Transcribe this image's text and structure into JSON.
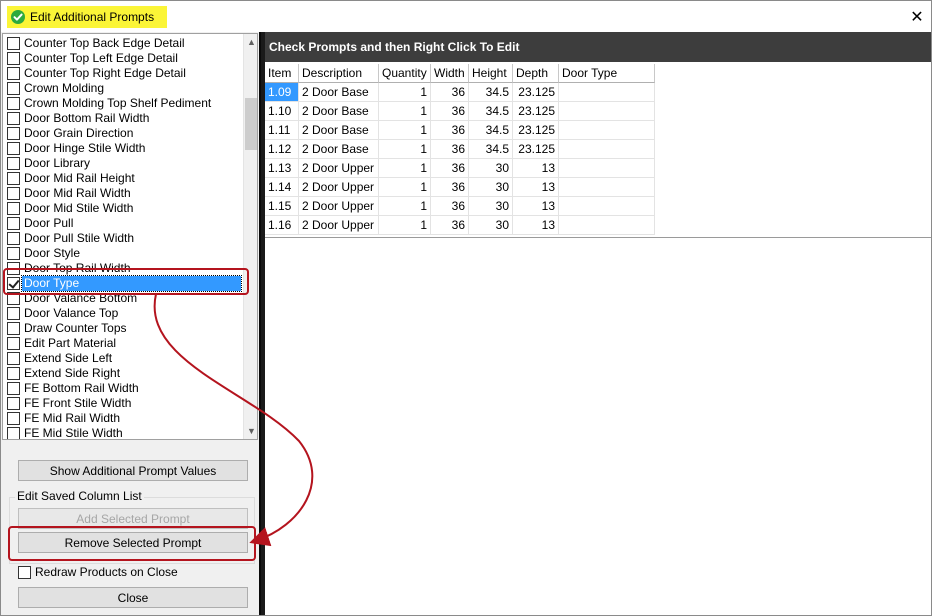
{
  "window": {
    "title": "Edit Additional Prompts",
    "close_glyph": "✕"
  },
  "prompt_list": {
    "items": [
      {
        "label": "Counter Top Back Edge Detail",
        "checked": false
      },
      {
        "label": "Counter Top Left Edge Detail",
        "checked": false
      },
      {
        "label": "Counter Top Right Edge Detail",
        "checked": false
      },
      {
        "label": "Crown Molding",
        "checked": false
      },
      {
        "label": "Crown Molding Top Shelf Pediment",
        "checked": false
      },
      {
        "label": "Door Bottom Rail Width",
        "checked": false
      },
      {
        "label": "Door Grain Direction",
        "checked": false
      },
      {
        "label": "Door Hinge Stile Width",
        "checked": false
      },
      {
        "label": "Door Library",
        "checked": false
      },
      {
        "label": "Door Mid Rail Height",
        "checked": false
      },
      {
        "label": "Door Mid Rail Width",
        "checked": false
      },
      {
        "label": "Door Mid Stile Width",
        "checked": false
      },
      {
        "label": "Door Pull",
        "checked": false
      },
      {
        "label": "Door Pull Stile Width",
        "checked": false
      },
      {
        "label": "Door Style",
        "checked": false
      },
      {
        "label": "Door Top Rail Width",
        "checked": false
      },
      {
        "label": "Door Type",
        "checked": true,
        "selected": true
      },
      {
        "label": "Door Valance Bottom",
        "checked": false
      },
      {
        "label": "Door Valance Top",
        "checked": false
      },
      {
        "label": "Draw Counter Tops",
        "checked": false
      },
      {
        "label": "Edit Part Material",
        "checked": false
      },
      {
        "label": "Extend Side Left",
        "checked": false
      },
      {
        "label": "Extend Side Right",
        "checked": false
      },
      {
        "label": "FE Bottom Rail Width",
        "checked": false
      },
      {
        "label": "FE Front Stile Width",
        "checked": false
      },
      {
        "label": "FE Mid Rail Width",
        "checked": false
      },
      {
        "label": "FE Mid Stile Width",
        "checked": false
      }
    ]
  },
  "buttons": {
    "show_values": "Show Additional Prompt Values",
    "add_selected": "Add Selected Prompt",
    "remove_selected": "Remove Selected Prompt",
    "close": "Close"
  },
  "saved_columns": {
    "group_label": "Edit Saved Column List"
  },
  "redraw": {
    "label": "Redraw Products on Close",
    "checked": false
  },
  "right_panel": {
    "header": "Check Prompts and then Right Click To Edit"
  },
  "grid": {
    "columns": [
      "Item",
      "Description",
      "Quantity",
      "Width",
      "Height",
      "Depth",
      "Door Type"
    ],
    "rows": [
      [
        "1.09",
        "2 Door Base",
        "1",
        "36",
        "34.5",
        "23.125",
        ""
      ],
      [
        "1.10",
        "2 Door Base",
        "1",
        "36",
        "34.5",
        "23.125",
        ""
      ],
      [
        "1.11",
        "2 Door Base",
        "1",
        "36",
        "34.5",
        "23.125",
        ""
      ],
      [
        "1.12",
        "2 Door Base",
        "1",
        "36",
        "34.5",
        "23.125",
        ""
      ],
      [
        "1.13",
        "2 Door Upper",
        "1",
        "36",
        "30",
        "13",
        ""
      ],
      [
        "1.14",
        "2 Door Upper",
        "1",
        "36",
        "30",
        "13",
        ""
      ],
      [
        "1.15",
        "2 Door Upper",
        "1",
        "36",
        "30",
        "13",
        ""
      ],
      [
        "1.16",
        "2 Door Upper",
        "1",
        "36",
        "30",
        "13",
        ""
      ]
    ],
    "selected_cell": [
      0,
      0
    ]
  },
  "colors": {
    "title_highlight": "#fbf537",
    "selection": "#3399ff",
    "header_bar": "#3d3d3d",
    "annotation_red": "#b4141e"
  }
}
